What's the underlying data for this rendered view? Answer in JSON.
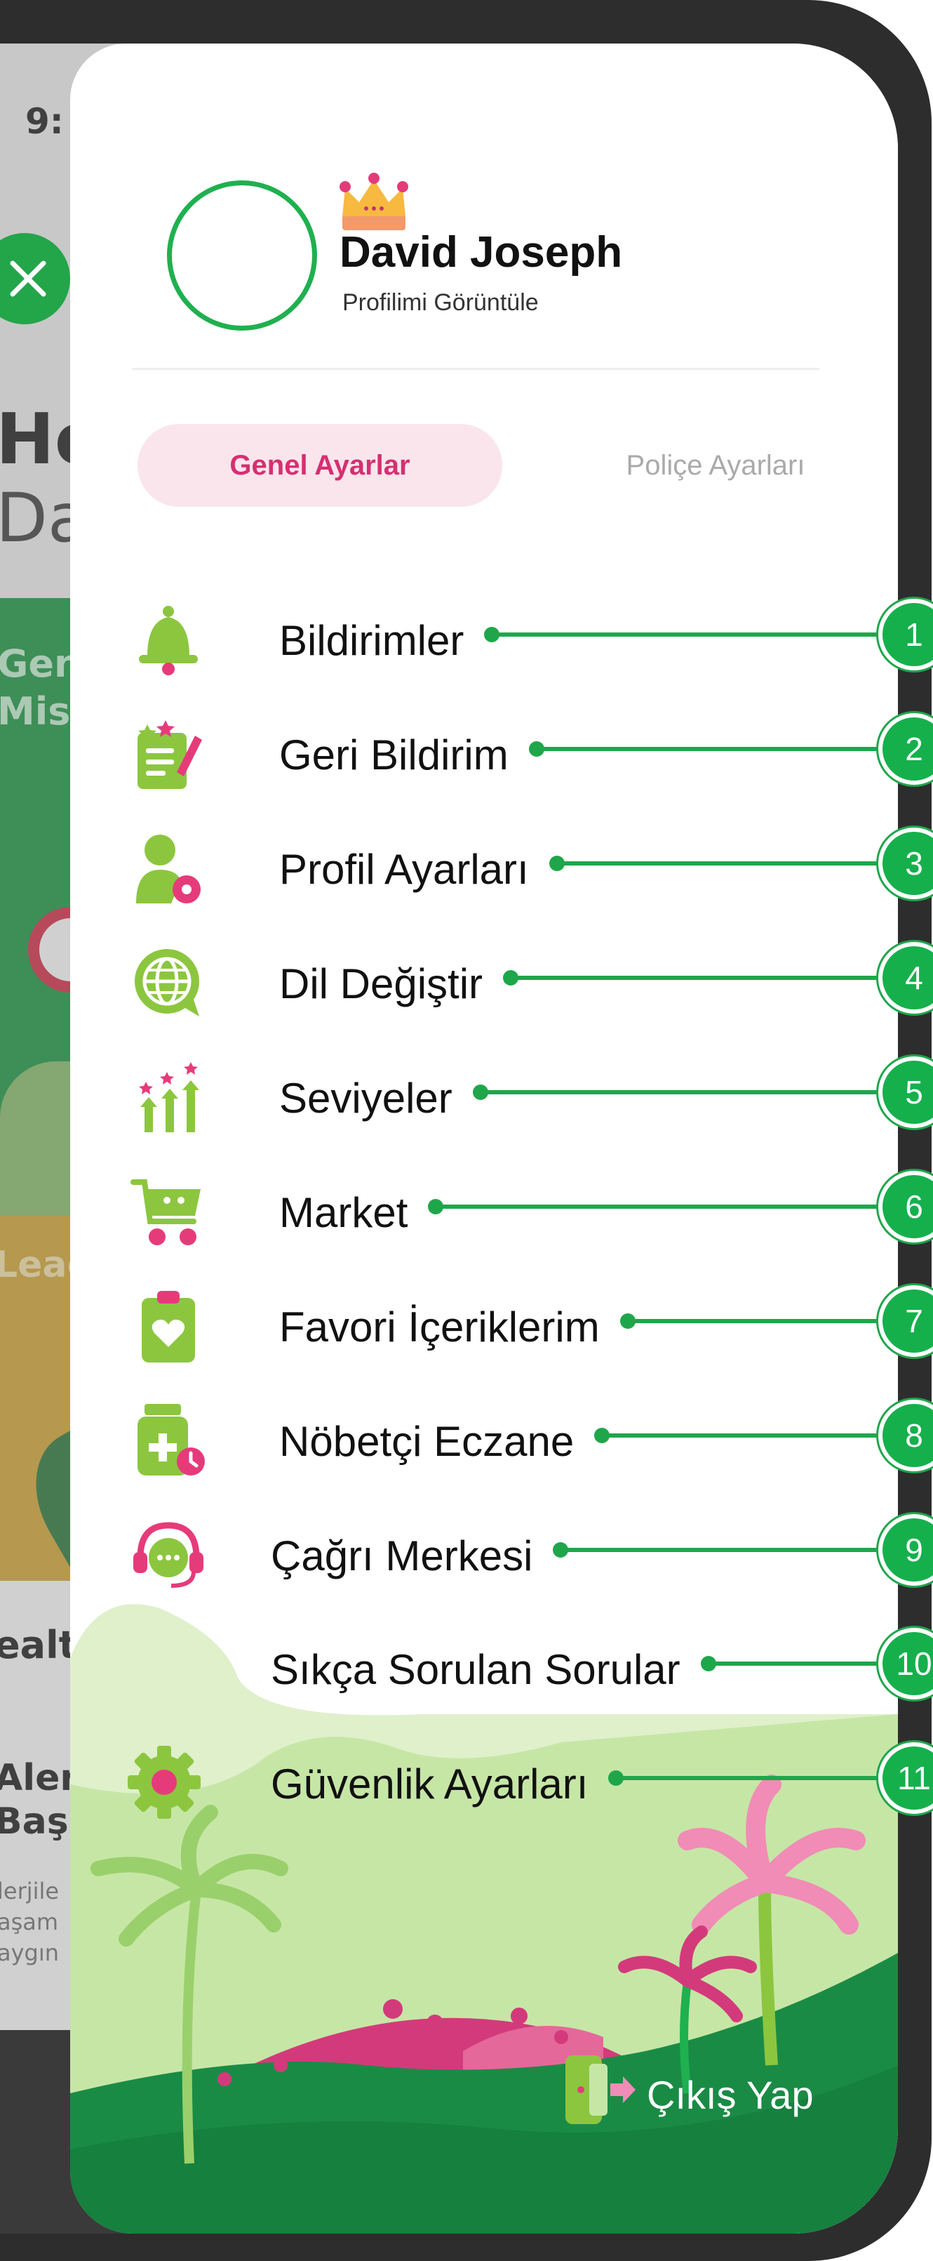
{
  "status_bar": {
    "time": "9:"
  },
  "background_app": {
    "heading_fragment": "He",
    "subheading_fragment": "Da",
    "card_text": "Gen\nMiss",
    "yellow_card_text": "Leac",
    "section_title": "ealt",
    "article_title": "Alerj\nBaşa",
    "article_excerpt": "lerjile\naşam\naygın"
  },
  "profile": {
    "name": "David Joseph",
    "view_profile_label": "Profilimi Görüntüle"
  },
  "tabs": [
    {
      "label": "Genel Ayarlar",
      "active": true
    },
    {
      "label": "Poliçe Ayarları",
      "active": false
    }
  ],
  "menu": [
    {
      "label": "Bildirimler",
      "icon": "bell-icon",
      "badge": "1"
    },
    {
      "label": "Geri Bildirim",
      "icon": "feedback-icon",
      "badge": "2"
    },
    {
      "label": "Profil Ayarları",
      "icon": "profile-settings-icon",
      "badge": "3"
    },
    {
      "label": "Dil Değiştir",
      "icon": "globe-icon",
      "badge": "4"
    },
    {
      "label": "Seviyeler",
      "icon": "levels-icon",
      "badge": "5"
    },
    {
      "label": "Market",
      "icon": "cart-icon",
      "badge": "6"
    },
    {
      "label": "Favori İçeriklerim",
      "icon": "favorite-clipboard-icon",
      "badge": "7"
    },
    {
      "label": "Nöbetçi Eczane",
      "icon": "pharmacy-icon",
      "badge": "8"
    },
    {
      "label": "Çağrı Merkesi",
      "icon": "call-center-icon",
      "badge": "9"
    },
    {
      "label": "Sıkça Sorulan Sorular",
      "icon": "faq-icon",
      "badge": "10"
    },
    {
      "label": "Güvenlik Ayarları",
      "icon": "gear-icon",
      "badge": "11"
    }
  ],
  "logout": {
    "label": "Çıkış Yap",
    "icon": "logout-icon"
  },
  "colors": {
    "primary_green": "#1fb04f",
    "accent_pink": "#d62f71",
    "tab_active_bg": "#fbe5ec",
    "footer_green": "#1a8b45"
  }
}
